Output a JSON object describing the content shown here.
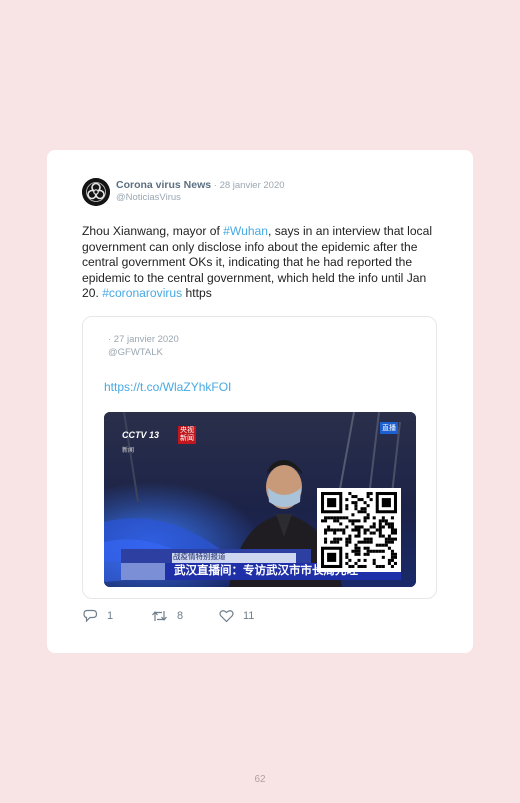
{
  "tweet": {
    "author_name": "Corona virus News",
    "date": " · 28 janvier 2020",
    "handle": "@NoticiasVirus",
    "text_part1": "Zhou Xianwang, mayor of ",
    "hashtag1": "#Wuhan",
    "text_part2": ", says in an interview that local government can only disclose info about the epidemic after the central government OKs it, indicating that he had reported the epidemic to the central government, which held the info until Jan 20. ",
    "hashtag2": "#coronarovirus",
    "text_part3": " https"
  },
  "quoted": {
    "date": " · 27 janvier 2020",
    "handle": "@GFWTALK",
    "link": "https://t.co/WlaZYhkFOI",
    "media": {
      "channel_logo": "CCTV 13",
      "channel_sub": "新闻",
      "program_logo": "央视新闻",
      "corner_badge": "直播",
      "ticker_small": "战疫情特别报道",
      "caption": "武汉直播间：专访武汉市市长周先旺"
    }
  },
  "actions": {
    "replies": "1",
    "retweets": "8",
    "likes": "11"
  },
  "page": {
    "number": "62"
  },
  "colors": {
    "background": "#f8e4e4",
    "card": "#ffffff",
    "link": "#47a9e3",
    "author": "#5b6f80",
    "meta": "#9aa7b2"
  }
}
